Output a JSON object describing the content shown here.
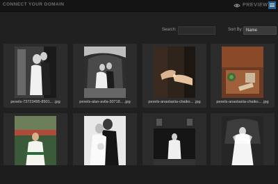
{
  "topbar": {
    "title": "CONNECT YOUR DOMAIN",
    "preview_label": "PREVIEW"
  },
  "toolbar": {
    "search_label": "Search:",
    "search_value": "",
    "sort_label": "Sort By:",
    "sort_value": "Name"
  },
  "photos": [
    {
      "caption": "pexels-73723495-8501... .jpg"
    },
    {
      "caption": "pexels-alan-avila-30718... .jpg"
    },
    {
      "caption": "pexels-anastasiia-chaiko... .jpg"
    },
    {
      "caption": "pexels-anastasiia-chaiko... .jpg"
    },
    {
      "caption": ""
    },
    {
      "caption": ""
    },
    {
      "caption": ""
    },
    {
      "caption": ""
    }
  ],
  "colors": {
    "background": "#1b1b1b",
    "card": "#2c2c2c",
    "accent": "#2a5f8f"
  }
}
